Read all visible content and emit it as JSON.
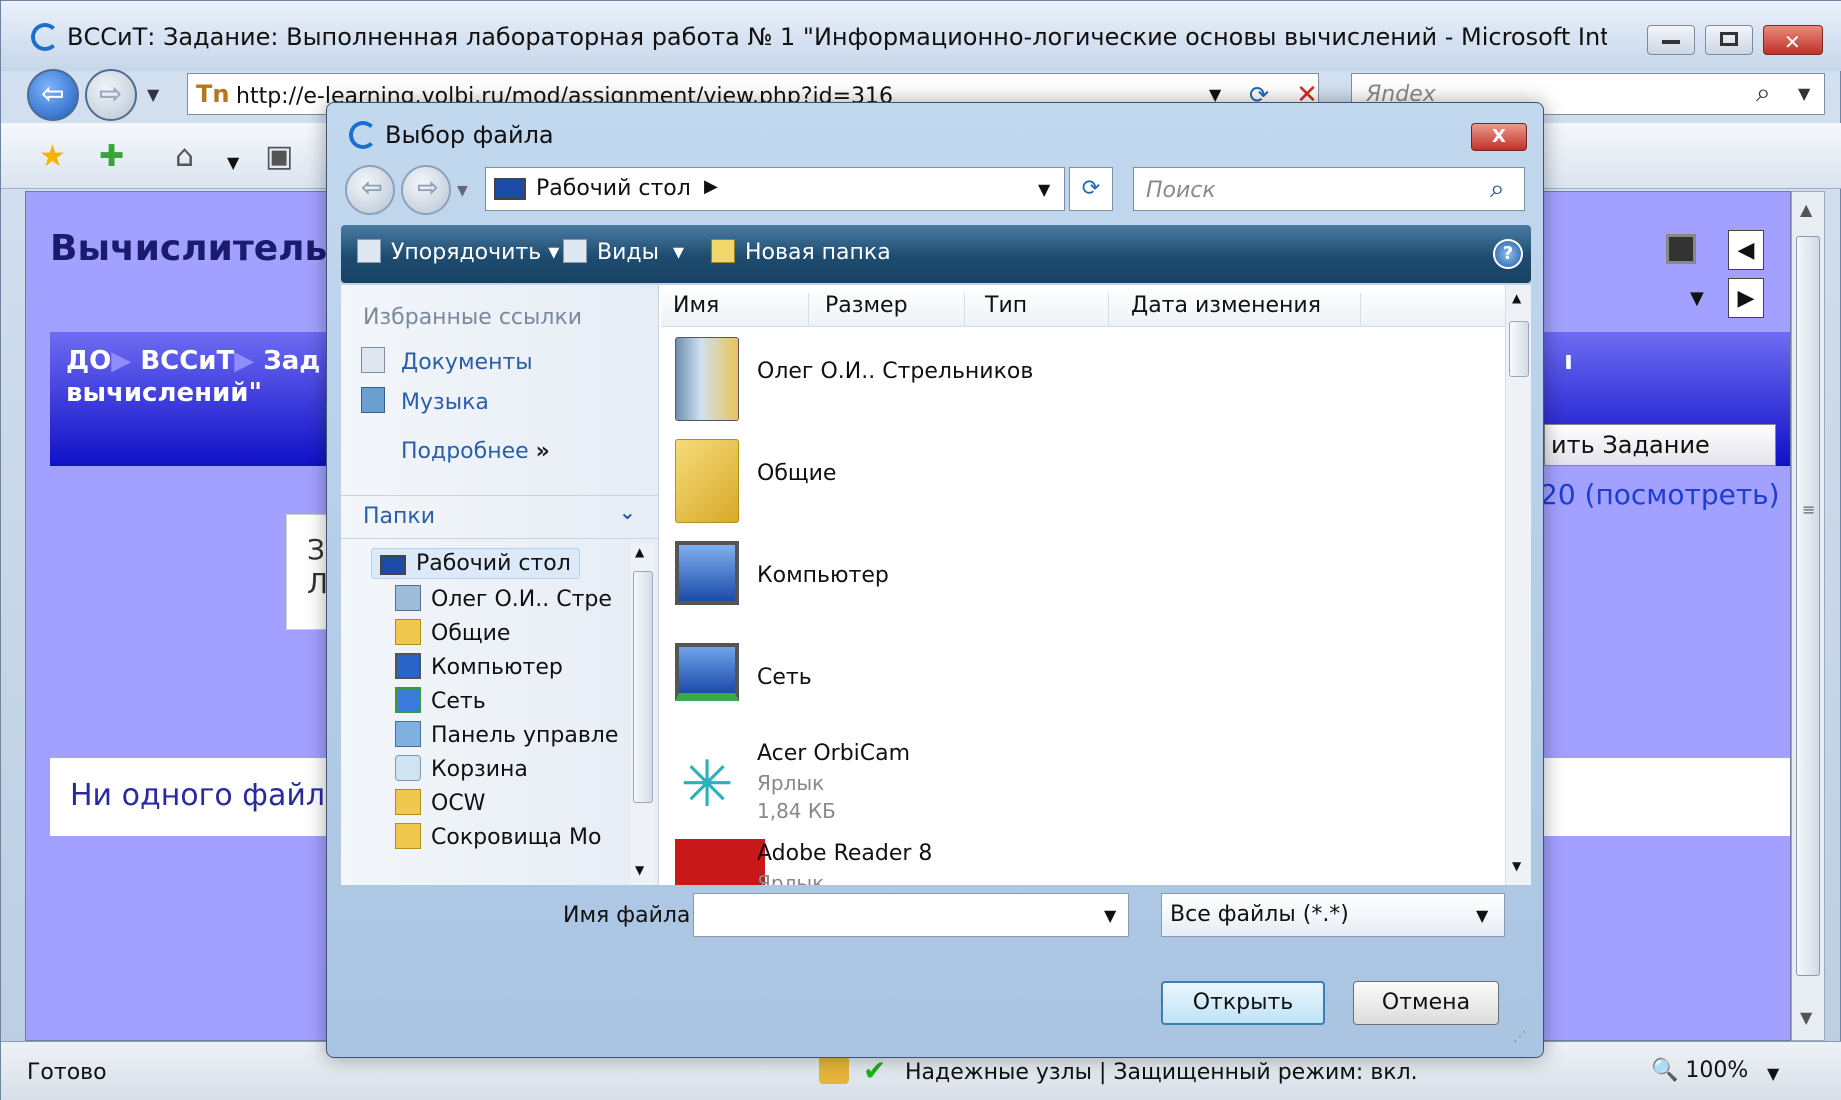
{
  "browser": {
    "title": "ВССиТ: Задание: Выполненная лабораторная работа № 1 \"Информационно-логические основы вычислений - Microsoft Internet Explorer п",
    "url": "http://e-learning.volbi.ru/mod/assignment/view.php?id=316",
    "search_placeholder": "Яndex",
    "status_left": "Готово",
    "status_zone": "Надежные узлы | Защищенный режим: вкл.",
    "zoom": "100%"
  },
  "page": {
    "heading": "Вычислитель",
    "breadcrumb_line1": [
      "ДО",
      "ВССиТ",
      "Зад"
    ],
    "breadcrumb_line2": "вычислений\"",
    "breadcrumb_right": "ı",
    "submit_partial": "ить Задание",
    "view_link": "20 (посмотреть)",
    "box_text": "З\nЛ",
    "no_files": "Ни одного файла"
  },
  "dialog": {
    "title": "Выбор файла",
    "close_label": "X",
    "path_label": "Рабочий стол",
    "search_placeholder": "Поиск",
    "toolbar": {
      "organize": "Упорядочить",
      "views": "Виды",
      "new_folder": "Новая папка",
      "help": "?"
    },
    "favorites_title": "Избранные ссылки",
    "favorites": [
      {
        "label": "Документы",
        "icon": "documents-icon"
      },
      {
        "label": "Музыка",
        "icon": "music-icon"
      }
    ],
    "more_label": "Подробнее",
    "more_glyph": "»",
    "folders_title": "Папки",
    "tree": [
      {
        "label": "Рабочий стол",
        "icon": "desktop-icon"
      },
      {
        "label": "Олег О.И.. Стре",
        "icon": "user-folder-icon"
      },
      {
        "label": "Общие",
        "icon": "folder-icon"
      },
      {
        "label": "Компьютер",
        "icon": "computer-icon"
      },
      {
        "label": "Сеть",
        "icon": "network-icon"
      },
      {
        "label": "Панель управле",
        "icon": "control-panel-icon"
      },
      {
        "label": "Корзина",
        "icon": "recycle-bin-icon"
      },
      {
        "label": "OCW",
        "icon": "folder-icon"
      },
      {
        "label": "Сокровища Мо",
        "icon": "folder-icon"
      }
    ],
    "columns": [
      "Имя",
      "Размер",
      "Тип",
      "Дата изменения"
    ],
    "files": [
      {
        "name": "Олег О.И.. Стрельников",
        "icon": "user-folder-icon"
      },
      {
        "name": "Общие",
        "icon": "folder-icon"
      },
      {
        "name": "Компьютер",
        "icon": "computer-icon"
      },
      {
        "name": "Сеть",
        "icon": "network-icon"
      },
      {
        "name": "Acer OrbiCam",
        "type": "Ярлык",
        "size": "1,84 КБ",
        "icon": "orbicam-shortcut-icon"
      },
      {
        "name": "Adobe Reader 8",
        "type": "Ярлык",
        "icon": "adobe-reader-icon"
      }
    ],
    "filename_label": "Имя файла:",
    "filename_value": "",
    "filetype": "Все файлы (*.*)",
    "open_label": "Открыть",
    "cancel_label": "Отмена"
  }
}
